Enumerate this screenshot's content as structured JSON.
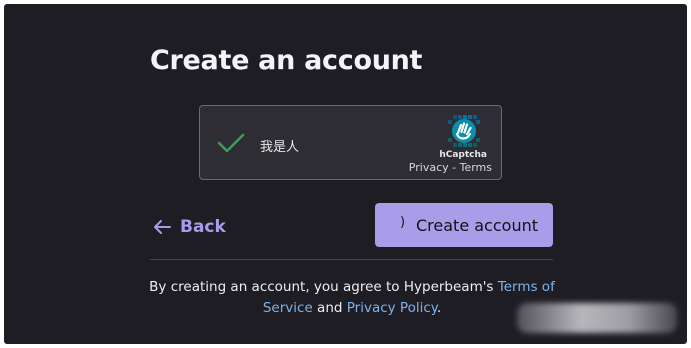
{
  "heading": "Create an account",
  "captcha": {
    "status_label": "我是人",
    "brand": "hCaptcha",
    "privacy_link": "Privacy",
    "separator": " - ",
    "terms_link": "Terms"
  },
  "actions": {
    "back_label": "Back",
    "create_label": "Create account",
    "loading_glyph": ")"
  },
  "legal": {
    "prefix": "By creating an account, you agree to Hyperbeam's ",
    "terms_link": "Terms of Service",
    "conjunction": " and ",
    "privacy_link": "Privacy Policy",
    "suffix": "."
  },
  "colors": {
    "background": "#1f1d24",
    "accent": "#a99ce9",
    "check": "#3f9a5a",
    "link": "#7fb2ea"
  },
  "icons": {
    "captcha_check": "check-icon",
    "captcha_logo": "hcaptcha-logo-icon",
    "back": "arrow-left-icon"
  }
}
